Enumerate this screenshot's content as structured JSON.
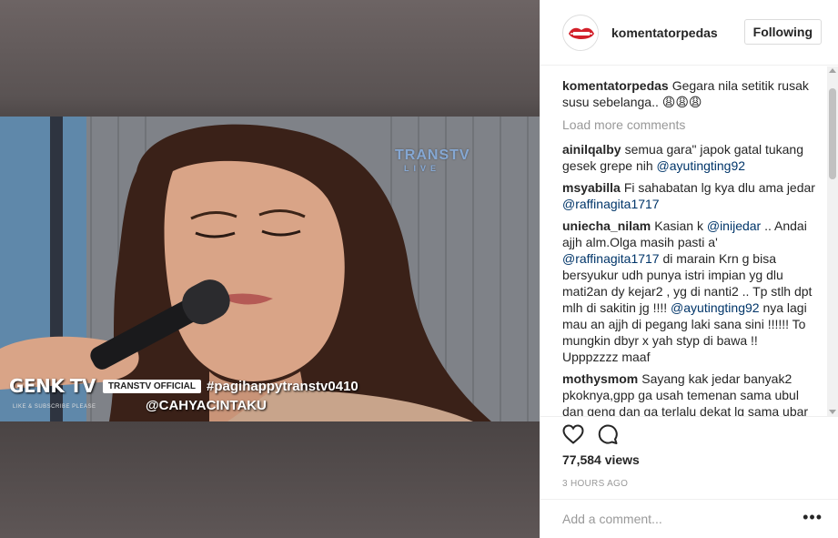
{
  "media": {
    "watermark_main": "TRANSTV",
    "watermark_sub": "LIVE",
    "channel_logo": "GENK TV",
    "channel_logo_sub": "LIKE & SUBSCRIBE PLEASE",
    "official_label": "TRANSTV OFFICIAL",
    "hashtag": "#pagihappytranstv0410",
    "video_handle": "@CAHYACINTAKU"
  },
  "header": {
    "username": "komentatorpedas",
    "follow_label": "Following"
  },
  "caption": {
    "username": "komentatorpedas",
    "text": "Gegara nila setitik rusak susu sebelanga.. 😩😩😩"
  },
  "load_more": "Load more comments",
  "comments": [
    {
      "username": "ainilqalby",
      "text": "semua gara\" japok gatal tukang gesek grepe nih",
      "mention": "@ayutingting92",
      "text2": ""
    },
    {
      "username": "msyabilla",
      "text": "Fi sahabatan lg kya dlu ama jedar",
      "mention": "@raffinagita1717",
      "text2": ""
    },
    {
      "username": "uniecha_nilam",
      "text": "Kasian k",
      "mention": "@inijedar",
      "text2": ".. Andai ajjh alm.Olga masih pasti a'",
      "mention2": "@raffinagita1717",
      "text3": "di marain Krn g bisa bersyukur udh punya istri impian yg dlu mati2an dy kejar2 , yg di nanti2 .. Tp stlh dpt mlh di sakitin jg !!!!",
      "mention3": "@ayutingting92",
      "text4": "nya lagi mau an ajjh di pegang laki sana sini !!!!!! To mungkin dbyr x yah styp di bawa !! Upppzzzz maaf"
    },
    {
      "username": "mothysmom",
      "text": "Sayang kak jedar banyak2 pkoknya,gpp ga usah temenan sama ubul dan geng dan ga terlalu dekat lg sama ubar"
    }
  ],
  "actions": {
    "like_icon": "heart-icon",
    "comment_icon": "comment-icon",
    "views": "77,584 views",
    "time": "3 HOURS AGO"
  },
  "add_comment": {
    "placeholder": "Add a comment...",
    "more": "•••"
  },
  "colors": {
    "text": "#262626",
    "muted": "#999999",
    "mention": "#003569",
    "border": "#efefef"
  }
}
